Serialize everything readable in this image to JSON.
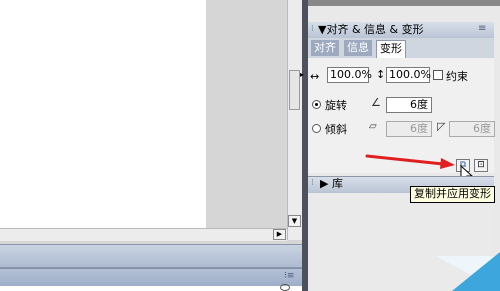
{
  "panel": {
    "title": "▼对齐 & 信息 & 变形",
    "options_icon": "panel-options-icon",
    "tabs": [
      "对齐",
      "信息",
      "变形"
    ],
    "active_tab": "变形"
  },
  "transform": {
    "width_value": "100.0%",
    "height_value": "100.0%",
    "constrain_label": "约束",
    "constrain_checked": false,
    "rotate_label": "旋转",
    "rotate_value": "6度",
    "rotate_selected": true,
    "skew_label": "倾斜",
    "skew_h_value": "6度",
    "skew_v_value": "6度"
  },
  "buttons": {
    "copy_apply_icon": "copy-and-apply-transform-icon",
    "reset_icon": "reset-transform-icon"
  },
  "library": {
    "title": "▶ 库"
  },
  "tooltip": {
    "text": "复制并应用变形"
  },
  "colors": {
    "panel_header": "#c7d0de",
    "tab_active": "#ffffff",
    "annotation_arrow": "#e02020",
    "tooltip_bg": "#ffffe1",
    "page_curl": "#3da6dd"
  }
}
